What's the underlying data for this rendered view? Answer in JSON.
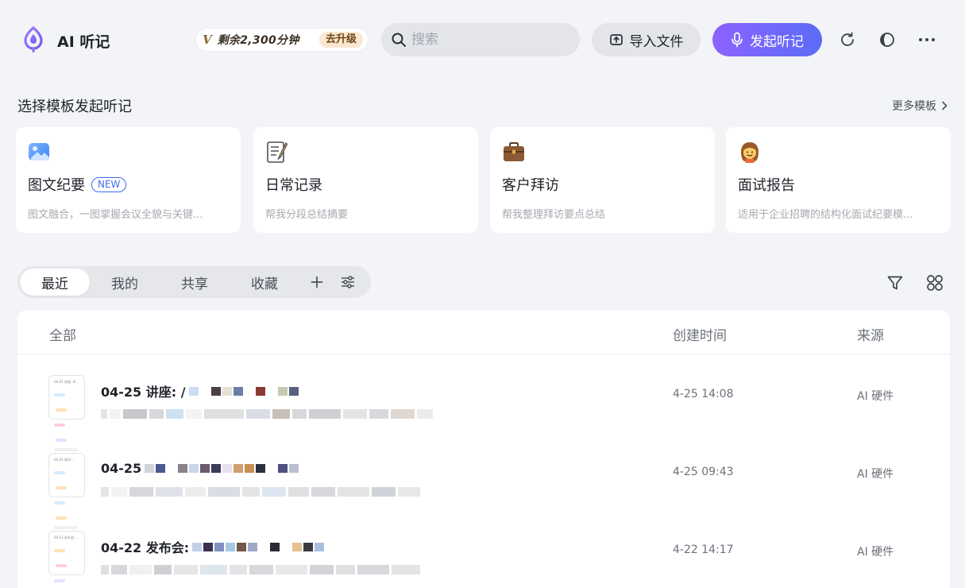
{
  "header": {
    "app_title": "AI 听记",
    "quota_prefix": "V",
    "quota_text": "剩余2,300分钟",
    "upgrade_label": "去升级",
    "search_placeholder": "搜索",
    "import_label": "导入文件",
    "start_label": "发起听记"
  },
  "templates": {
    "section_title": "选择模板发起听记",
    "more_label": "更多模板",
    "cards": [
      {
        "title": "图文纪要",
        "badge": "NEW",
        "desc": "图文融合，一图掌握会议全貌与关键...",
        "icon": "image-icon"
      },
      {
        "title": "日常记录",
        "desc": "帮我分段总结摘要",
        "icon": "memo-icon"
      },
      {
        "title": "客户拜访",
        "desc": "帮我整理拜访要点总结",
        "icon": "briefcase-icon"
      },
      {
        "title": "面试报告",
        "desc": "适用于企业招聘的结构化面试纪要模...",
        "icon": "person-icon"
      }
    ]
  },
  "tabs": {
    "items": [
      "最近",
      "我的",
      "共享",
      "收藏"
    ],
    "active": "最近"
  },
  "list": {
    "columns": [
      "全部",
      "创建时间",
      "来源"
    ],
    "rows": [
      {
        "title_prefix": "04-25 讲座: /",
        "thumb_label": "04-25 讲座: AI...",
        "time": "4-25 14:08",
        "source": "AI 硬件"
      },
      {
        "title_prefix": "04-25 ",
        "thumb_label": "04-25 测评:...",
        "time": "4-25 09:43",
        "source": "AI 硬件"
      },
      {
        "title_prefix": "04-22 发布会: ",
        "thumb_label": "04-22 发布会:...",
        "time": "4-22 14:17",
        "source": "AI 硬件"
      }
    ]
  },
  "colors": {
    "accent_start": "#8c62ff",
    "accent_end": "#5b6cf7",
    "new_badge": "#3b6df0",
    "upgrade_bg": "#fbe7cf"
  }
}
